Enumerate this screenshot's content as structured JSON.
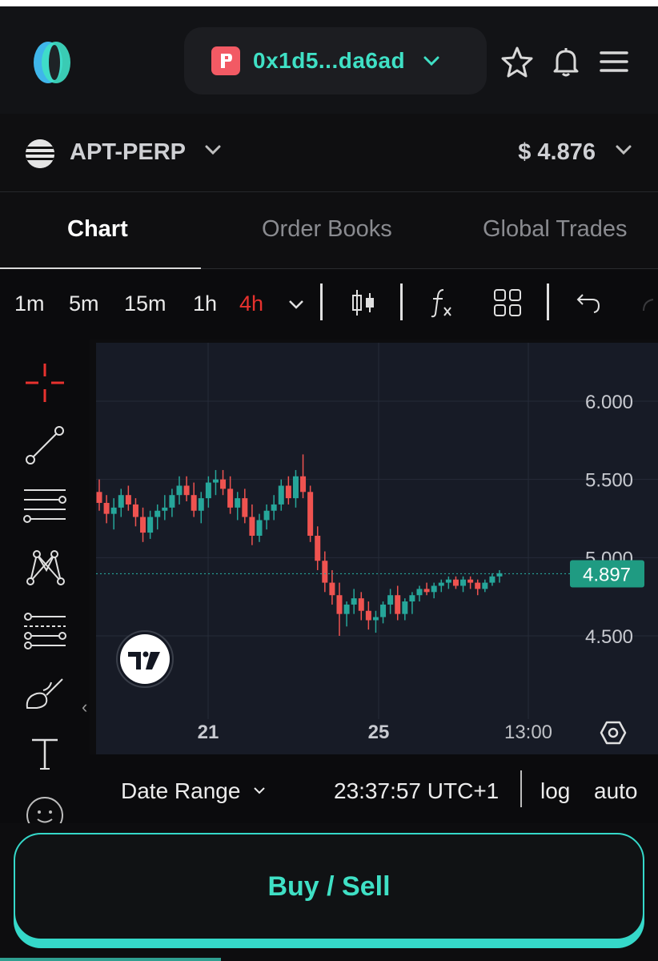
{
  "header": {
    "wallet_address": "0x1d5...da6ad",
    "icons": [
      "logo-icon",
      "wallet-icon",
      "chevron-down-icon",
      "star-icon",
      "bell-icon",
      "menu-icon"
    ]
  },
  "market": {
    "name": "APT-PERP",
    "price": "$ 4.876"
  },
  "tabs": [
    {
      "label": "Chart",
      "active": true
    },
    {
      "label": "Order Books",
      "active": false
    },
    {
      "label": "Global Trades",
      "active": false
    }
  ],
  "toolbar": {
    "timeframes": [
      "1m",
      "5m",
      "15m",
      "1h",
      "4h"
    ],
    "selected_timeframe": "4h",
    "icons": [
      "candlestick-icon",
      "indicators-icon",
      "layout-icon",
      "undo-icon"
    ]
  },
  "drawing_tools": [
    "crosshair-icon",
    "trend-line-icon",
    "horizontal-lines-icon",
    "pattern-icon",
    "fib-icon",
    "brush-icon",
    "text-icon",
    "emoji-icon"
  ],
  "chart_footer": {
    "date_range_label": "Date Range",
    "time": "23:37:57 UTC+1",
    "log_label": "log",
    "auto_label": "auto"
  },
  "action": {
    "buy_sell_label": "Buy / Sell"
  },
  "colors": {
    "accent": "#3fe0c5",
    "up": "#26a69a",
    "down": "#ef5350",
    "chart_bg": "#171b26",
    "selected_timeframe": "#e8322e"
  },
  "chart_data": {
    "type": "candlestick",
    "y_ticks": [
      "6.000",
      "5.500",
      "5.000",
      "4.500"
    ],
    "x_ticks": [
      "21",
      "25",
      "13:00"
    ],
    "ylim": [
      4.2,
      6.4
    ],
    "last_price_label": "4.897",
    "last_price": 4.897,
    "grid": true,
    "candles": [
      [
        5.42,
        5.5,
        5.3,
        5.35
      ],
      [
        5.35,
        5.4,
        5.22,
        5.28
      ],
      [
        5.28,
        5.38,
        5.18,
        5.32
      ],
      [
        5.32,
        5.44,
        5.26,
        5.4
      ],
      [
        5.4,
        5.46,
        5.3,
        5.34
      ],
      [
        5.34,
        5.38,
        5.2,
        5.26
      ],
      [
        5.26,
        5.32,
        5.1,
        5.16
      ],
      [
        5.16,
        5.3,
        5.12,
        5.26
      ],
      [
        5.26,
        5.34,
        5.18,
        5.3
      ],
      [
        5.3,
        5.4,
        5.24,
        5.32
      ],
      [
        5.32,
        5.44,
        5.26,
        5.4
      ],
      [
        5.4,
        5.52,
        5.34,
        5.46
      ],
      [
        5.46,
        5.52,
        5.36,
        5.4
      ],
      [
        5.4,
        5.48,
        5.26,
        5.3
      ],
      [
        5.3,
        5.42,
        5.22,
        5.38
      ],
      [
        5.38,
        5.52,
        5.32,
        5.48
      ],
      [
        5.48,
        5.56,
        5.4,
        5.5
      ],
      [
        5.5,
        5.56,
        5.4,
        5.44
      ],
      [
        5.44,
        5.52,
        5.28,
        5.32
      ],
      [
        5.32,
        5.42,
        5.24,
        5.38
      ],
      [
        5.38,
        5.44,
        5.22,
        5.26
      ],
      [
        5.26,
        5.34,
        5.08,
        5.14
      ],
      [
        5.14,
        5.28,
        5.1,
        5.24
      ],
      [
        5.24,
        5.34,
        5.18,
        5.3
      ],
      [
        5.3,
        5.4,
        5.24,
        5.34
      ],
      [
        5.34,
        5.5,
        5.3,
        5.46
      ],
      [
        5.46,
        5.52,
        5.34,
        5.38
      ],
      [
        5.38,
        5.56,
        5.32,
        5.52
      ],
      [
        5.52,
        5.66,
        5.38,
        5.42
      ],
      [
        5.42,
        5.46,
        5.1,
        5.14
      ],
      [
        5.14,
        5.2,
        4.92,
        4.98
      ],
      [
        4.98,
        5.04,
        4.78,
        4.84
      ],
      [
        4.84,
        4.92,
        4.7,
        4.76
      ],
      [
        4.76,
        4.84,
        4.5,
        4.64
      ],
      [
        4.64,
        4.72,
        4.56,
        4.7
      ],
      [
        4.7,
        4.8,
        4.64,
        4.74
      ],
      [
        4.74,
        4.78,
        4.6,
        4.66
      ],
      [
        4.66,
        4.72,
        4.54,
        4.6
      ],
      [
        4.6,
        4.66,
        4.52,
        4.62
      ],
      [
        4.62,
        4.72,
        4.58,
        4.7
      ],
      [
        4.7,
        4.8,
        4.64,
        4.76
      ],
      [
        4.76,
        4.82,
        4.6,
        4.64
      ],
      [
        4.64,
        4.74,
        4.6,
        4.72
      ],
      [
        4.72,
        4.78,
        4.64,
        4.76
      ],
      [
        4.76,
        4.82,
        4.72,
        4.8
      ],
      [
        4.8,
        4.84,
        4.76,
        4.78
      ],
      [
        4.78,
        4.84,
        4.74,
        4.82
      ],
      [
        4.82,
        4.86,
        4.78,
        4.84
      ],
      [
        4.84,
        4.88,
        4.8,
        4.86
      ],
      [
        4.86,
        4.88,
        4.8,
        4.82
      ],
      [
        4.82,
        4.88,
        4.78,
        4.86
      ],
      [
        4.86,
        4.88,
        4.8,
        4.84
      ],
      [
        4.84,
        4.86,
        4.76,
        4.8
      ],
      [
        4.8,
        4.86,
        4.78,
        4.84
      ],
      [
        4.84,
        4.9,
        4.82,
        4.88
      ],
      [
        4.88,
        4.92,
        4.84,
        4.9
      ]
    ]
  }
}
